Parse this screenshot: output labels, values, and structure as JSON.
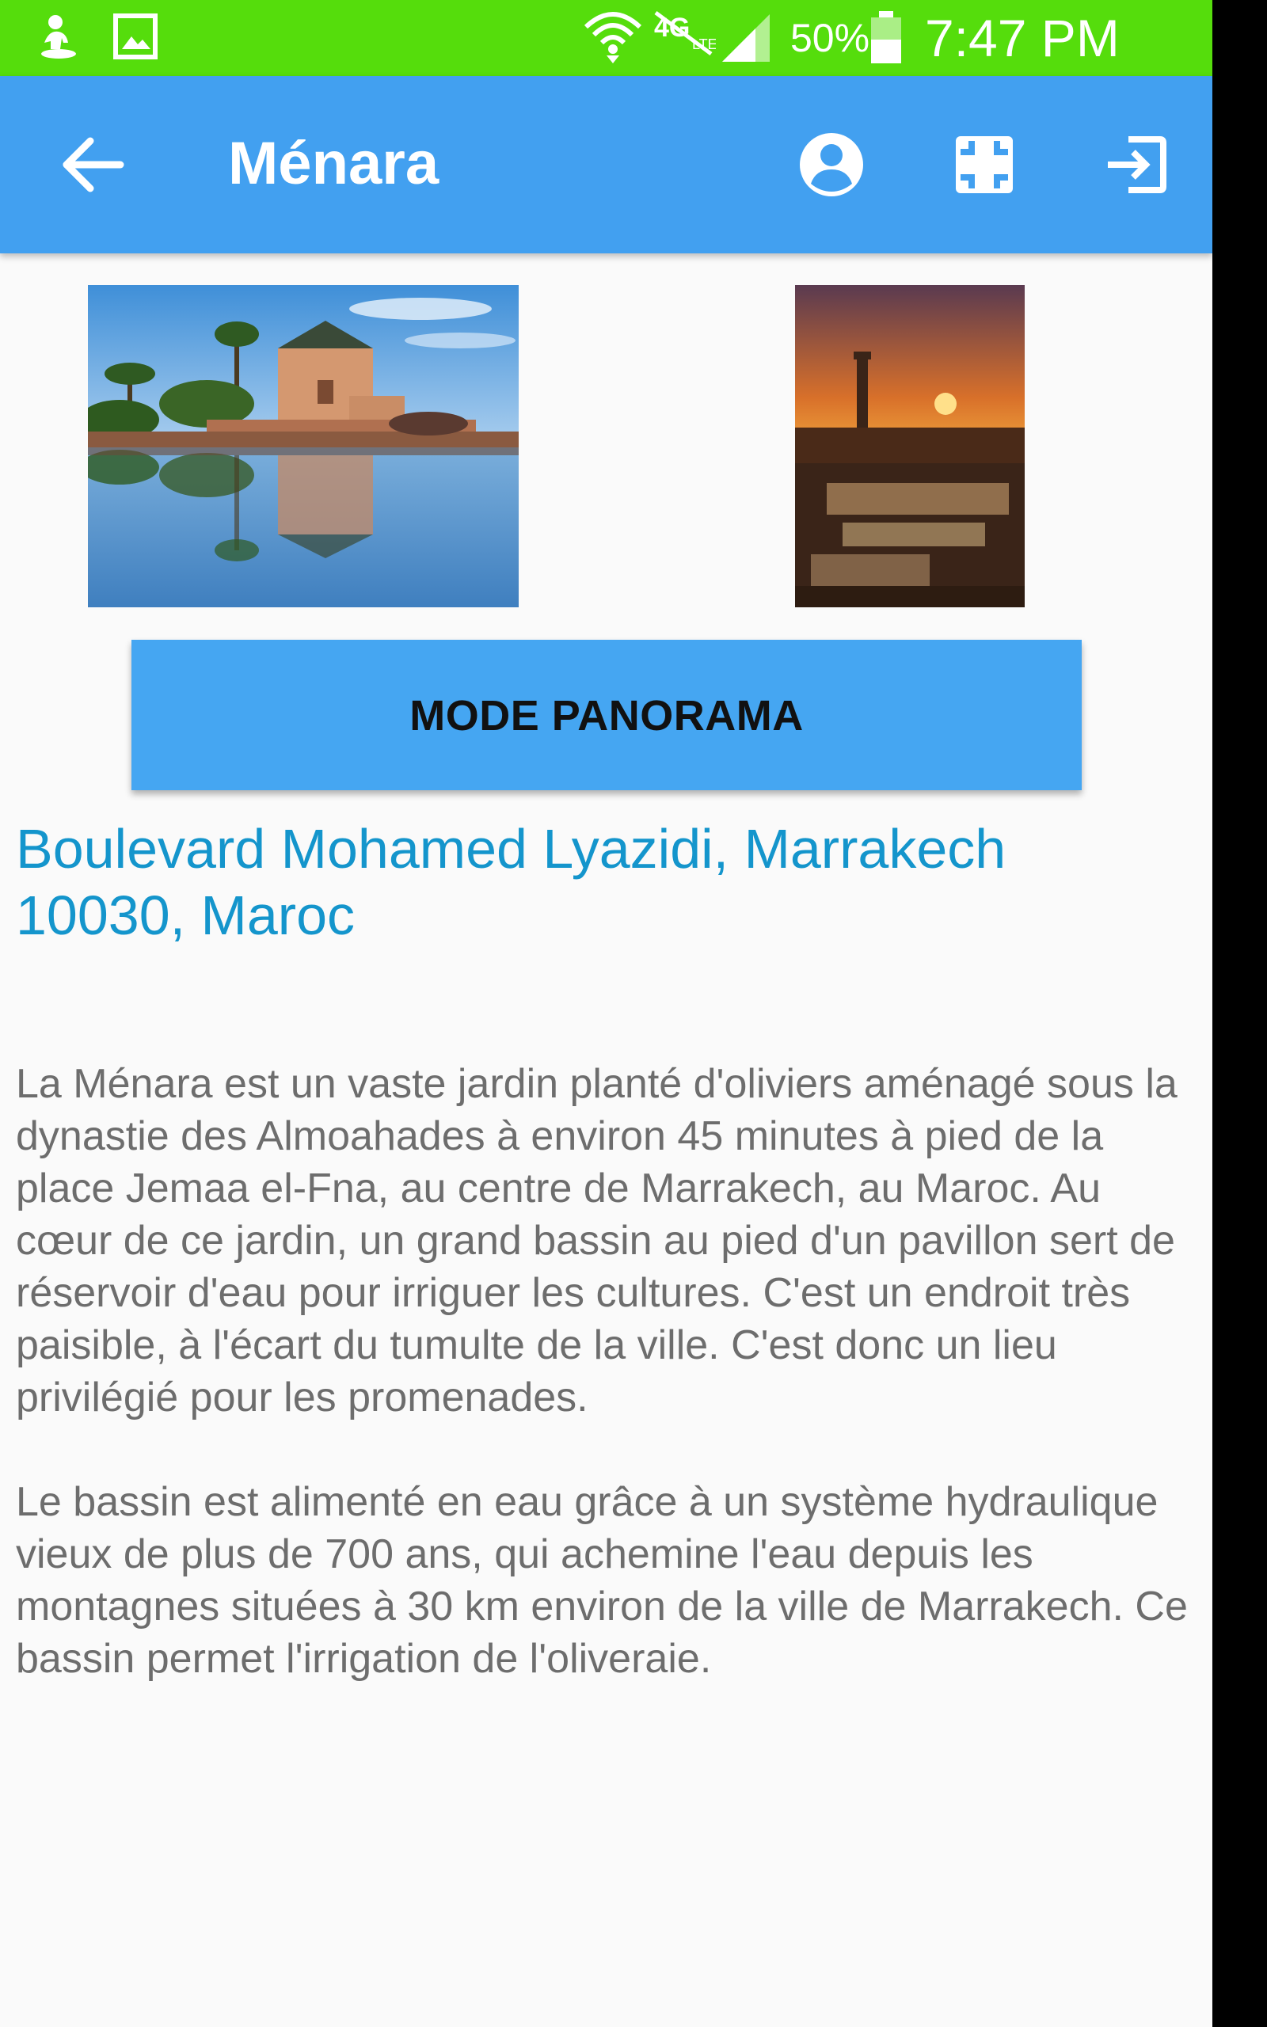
{
  "status_bar": {
    "battery_percent": "50%",
    "time": "7:47 PM",
    "icons": [
      "notification-figure-icon",
      "gallery-icon",
      "wifi-icon",
      "4g-lte-icon",
      "signal-icon",
      "battery-icon"
    ]
  },
  "app_bar": {
    "title": "Ménara",
    "icons": [
      "back-arrow-icon",
      "account-circle-icon",
      "fullscreen-icon",
      "exit-icon"
    ]
  },
  "images": [
    {
      "subject": "Ménara pavilion reflected in basin"
    },
    {
      "subject": "Jemaa el-Fna square at sunset"
    }
  ],
  "panorama_button": {
    "label": "MODE PANORAMA"
  },
  "address": "Boulevard Mohamed Lyazidi,  Marrakech 10030, Maroc",
  "description": {
    "paragraph1": "La Ménara  est un vaste jardin planté d'oliviers aménagé sous la dynastie des Almoahades à environ 45 minutes à pied de la place Jemaa el-Fna, au centre de Marrakech, au Maroc. Au cœur de ce jardin, un grand bassin au pied d'un pavillon sert de réservoir d'eau pour irriguer les cultures. C'est un endroit très paisible, à l'écart du tumulte de la ville. C'est donc un lieu privilégié pour les promenades.",
    "paragraph2": "Le bassin est alimenté en eau grâce à un système hydraulique vieux de plus de 700 ans, qui achemine l'eau depuis les montagnes situées à 30 km environ de la ville de Marrakech. Ce bassin permet l'irrigation de l'oliveraie."
  },
  "colors": {
    "status_bar": "#55dd0c",
    "app_bar": "#42a0f0",
    "button": "#45a6f2",
    "address_text": "#1495cc",
    "body_text": "#6d6d6d"
  }
}
